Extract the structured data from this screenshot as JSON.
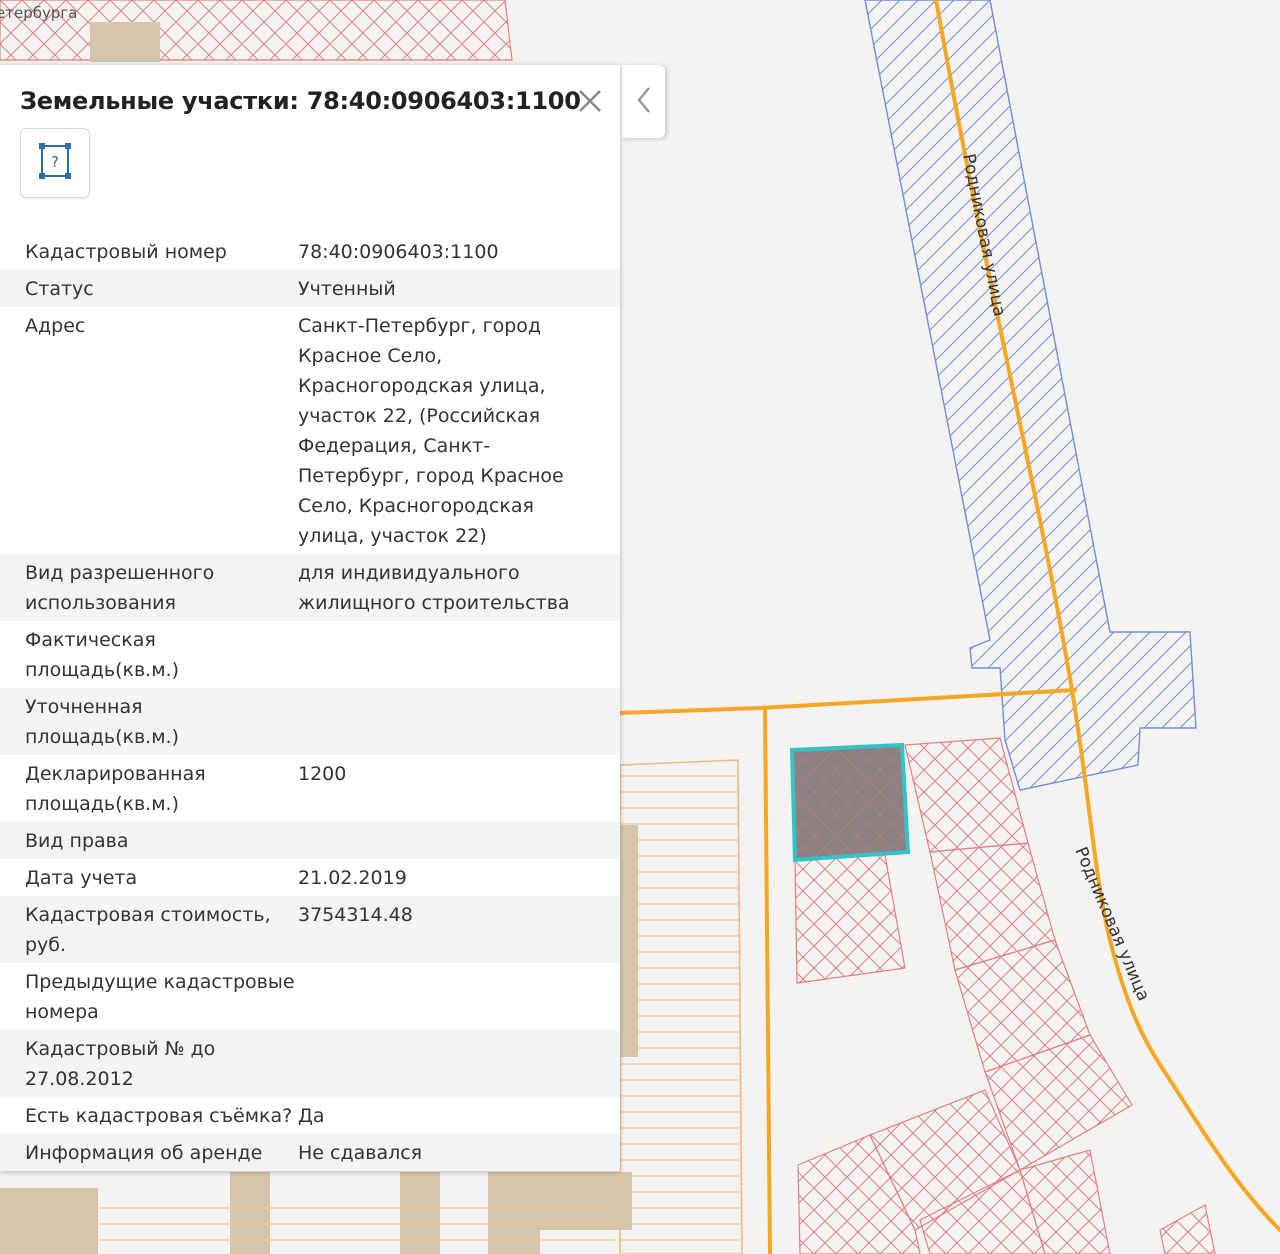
{
  "map": {
    "street_label_upper": "Родниковая улица",
    "street_label_lower": "Родниковая улица",
    "city_label_fragment": "етербурга",
    "colors": {
      "background": "#f4f3f1",
      "parcel_hatch": "#e08080",
      "road_hatch": "#6f8fdc",
      "road_line": "#f5a623",
      "building": "#d6c5ad",
      "selected_fill": "#8c8083",
      "selected_border": "#2ec5c8"
    }
  },
  "panel": {
    "title": "Земельные участки: 78:40:0906403:1100",
    "geometry_button_glyph": "?",
    "rows": [
      {
        "key": "Кадастровый номер",
        "value": "78:40:0906403:1100"
      },
      {
        "key": "Статус",
        "value": "Учтенный"
      },
      {
        "key": "Адрес",
        "value": "Санкт-Петербург, город Красное Село, Красногородская улица, участок 22, (Российская Федерация, Санкт-Петербург, город Красное Село, Красногородская улица, участок 22)"
      },
      {
        "key": "Вид разрешенного использования",
        "value": "для индивидуального жилищного строительства"
      },
      {
        "key": "Фактическая площадь(кв.м.)",
        "value": ""
      },
      {
        "key": "Уточненная площадь(кв.м.)",
        "value": ""
      },
      {
        "key": "Декларированная площадь(кв.м.)",
        "value": "1200"
      },
      {
        "key": "Вид права",
        "value": ""
      },
      {
        "key": "Дата учета",
        "value": "21.02.2019"
      },
      {
        "key": "Кадастровая стоимость, руб.",
        "value": "3754314.48"
      },
      {
        "key": "Предыдущие кадастровые номера",
        "value": ""
      },
      {
        "key": "Кадастровый № до 27.08.2012",
        "value": ""
      },
      {
        "key": "Есть кадастровая съёмка?",
        "value": "Да"
      },
      {
        "key": "Информация об аренде",
        "value": "Не сдавался"
      }
    ]
  },
  "icons": {
    "close": "close-icon",
    "geometry": "geometry-icon",
    "collapse": "chevron-left-icon"
  }
}
